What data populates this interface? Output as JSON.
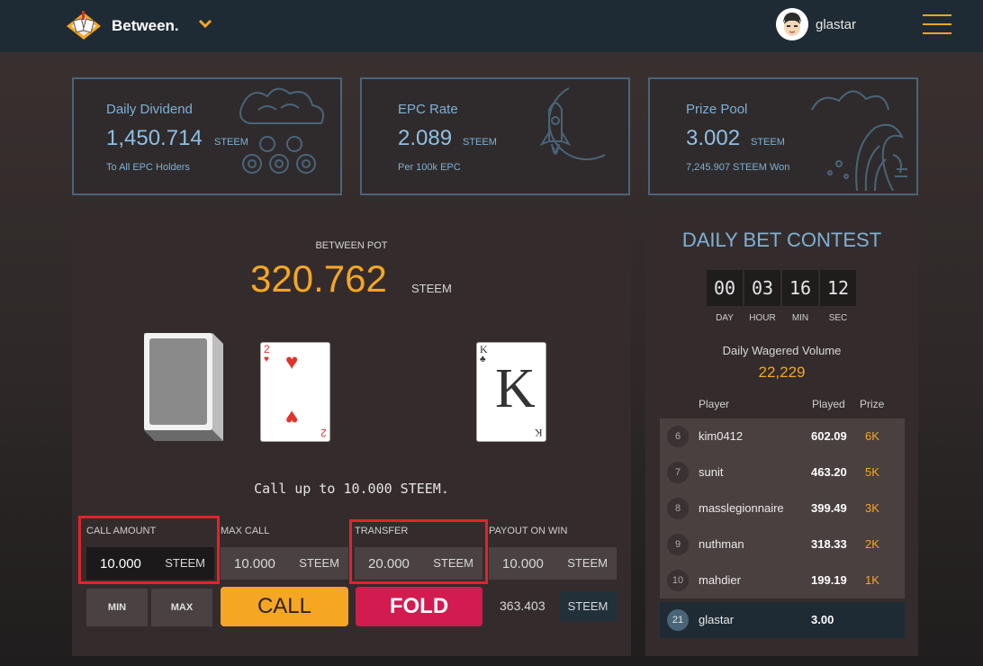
{
  "header": {
    "brand": "Between.",
    "username": "glastar"
  },
  "stats": [
    {
      "label": "Daily Dividend",
      "value": "1,450.714",
      "unit": "STEEM",
      "sub": "To All EPC Holders"
    },
    {
      "label": "EPC Rate",
      "value": "2.089",
      "unit": "STEEM",
      "sub": "Per 100k EPC"
    },
    {
      "label": "Prize Pool",
      "value": "3.002",
      "unit": "STEEM",
      "sub": "7,245.907 STEEM Won"
    }
  ],
  "game": {
    "pot_label": "BETWEEN POT",
    "pot_value": "320.762",
    "pot_unit": "STEEM",
    "card_left": {
      "rank": "2",
      "suit": "♥"
    },
    "card_right": {
      "rank": "K",
      "suit": "♣"
    },
    "call_text": "Call up to 10.000 STEEM.",
    "fields": [
      {
        "label": "CALL AMOUNT",
        "value": "10.000",
        "unit": "STEEM"
      },
      {
        "label": "MAX CALL",
        "value": "10.000",
        "unit": "STEEM"
      },
      {
        "label": "TRANSFER",
        "value": "20.000",
        "unit": "STEEM"
      },
      {
        "label": "PAYOUT ON WIN",
        "value": "10.000",
        "unit": "STEEM"
      }
    ],
    "min_label": "MIN",
    "max_label": "MAX",
    "call_label": "CALL",
    "fold_label": "FOLD",
    "balance": "363.403",
    "balance_unit": "STEEM"
  },
  "contest": {
    "title": "DAILY BET CONTEST",
    "timer": [
      {
        "value": "00",
        "caption": "DAY"
      },
      {
        "value": "03",
        "caption": "HOUR"
      },
      {
        "value": "16",
        "caption": "MIN"
      },
      {
        "value": "12",
        "caption": "SEC"
      }
    ],
    "wager_label": "Daily Wagered Volume",
    "wager_value": "22,229",
    "columns": {
      "player": "Player",
      "played": "Played",
      "prize": "Prize"
    },
    "rows": [
      {
        "rank": "6",
        "player": "kim0412",
        "played": "602.09",
        "prize": "6K"
      },
      {
        "rank": "7",
        "player": "sunit",
        "played": "463.20",
        "prize": "5K"
      },
      {
        "rank": "8",
        "player": "masslegionnaire",
        "played": "399.49",
        "prize": "3K"
      },
      {
        "rank": "9",
        "player": "nuthman",
        "played": "318.33",
        "prize": "2K"
      },
      {
        "rank": "10",
        "player": "mahdier",
        "played": "199.19",
        "prize": "1K"
      }
    ],
    "me": {
      "rank": "21",
      "player": "glastar",
      "played": "3.00"
    }
  },
  "colors": {
    "accent": "#f5a623",
    "fold": "#d21b4f",
    "info": "#7fb0d4",
    "highlight": "#e0242a"
  }
}
